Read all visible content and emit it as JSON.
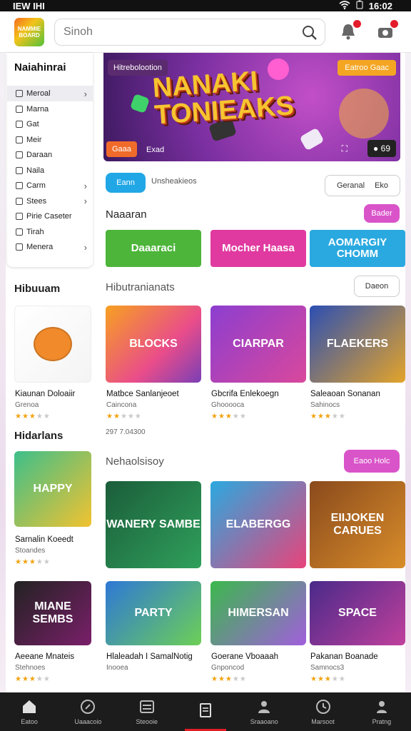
{
  "status": {
    "left": "IEW IHI",
    "right": "16:02"
  },
  "header": {
    "logo_text": "NAMMIE BOARD",
    "search_placeholder": "Sinoh"
  },
  "sidebar": {
    "title": "Naiahinrai",
    "items": [
      {
        "label": "Meroal",
        "chevron": true,
        "active": true
      },
      {
        "label": "Marna",
        "chevron": false
      },
      {
        "label": "Gat",
        "chevron": false
      },
      {
        "label": "Meir",
        "chevron": false
      },
      {
        "label": "Daraan",
        "chevron": false
      },
      {
        "label": "Naila",
        "chevron": false
      },
      {
        "label": "Carm",
        "chevron": true
      },
      {
        "label": "Stees",
        "chevron": true
      },
      {
        "label": "Pirie Caseter",
        "chevron": false
      },
      {
        "label": "Tirah",
        "chevron": false
      },
      {
        "label": "Menera",
        "chevron": true
      }
    ]
  },
  "hero": {
    "tag": "Hitrebolootion",
    "cta": "Eatroo Gaac",
    "title_line1": "NANAKI",
    "title_line2": "TONIEAKS",
    "badge": "Gaaa",
    "badge2": "Exad",
    "counter": "69"
  },
  "filters": {
    "primary": "Eann",
    "subtitle": "Unsheakieos",
    "secondary_a": "Geranal",
    "secondary_b": "Eko"
  },
  "featured": {
    "title": "Naaaran",
    "button": "Bader",
    "banners": [
      {
        "label": "Daaaraci",
        "color": "#4db53a"
      },
      {
        "label": "Mocher Haasa",
        "color": "#e03aa0"
      },
      {
        "label": "AOMARGIY CHOMM",
        "color": "#2aa9e0"
      }
    ]
  },
  "section1": {
    "title": "Hibuuam",
    "subtitle": "Hibutranianats",
    "button": "Daeon",
    "cards": [
      {
        "title": "Kiaunan Doloaiir",
        "sub": "Grenoa",
        "rating": 3,
        "art": "FOX"
      },
      {
        "title": "Matbce Sanlanjeoet",
        "sub": "Caincona",
        "rating": 2,
        "art": "BLOCKS"
      },
      {
        "title": "Gbcrifa Enlekoegn",
        "sub": "Ghooooca",
        "rating": 3,
        "art": "CIARPAR"
      },
      {
        "title": "Saleaoan Sonanan",
        "sub": "Sahinocs",
        "rating": 3,
        "art": "FLAEKERS"
      }
    ],
    "meta": "297 7.04300"
  },
  "section2": {
    "title": "Hidarlans",
    "subtitle": "Nehaolsisoy",
    "button": "Eaoo Holc",
    "cards": [
      {
        "title": "Sarnalin Koeedt",
        "sub": "Stoandes",
        "rating": 3,
        "art": "HAPPY"
      },
      {
        "title": "",
        "sub": "",
        "rating": 0,
        "art": "WANERY SAMBE"
      },
      {
        "title": "",
        "sub": "",
        "rating": 0,
        "art": "ELABERGG"
      },
      {
        "title": "",
        "sub": "",
        "rating": 0,
        "art": "EIIJOKEN CARUES"
      }
    ]
  },
  "section3": {
    "cards": [
      {
        "title": "Aeeane Mnateis",
        "sub": "Stehnoes",
        "rating": 3,
        "art": "MIANE SEMBS"
      },
      {
        "title": "Hlaleadah I SamalNotig",
        "sub": "Inooea",
        "rating": 0,
        "art": "PARTY"
      },
      {
        "title": "Goerane Vboaaah",
        "sub": "Gnponcod",
        "rating": 3,
        "art": "HIMERSAN"
      },
      {
        "title": "Pakanan Boanade",
        "sub": "Samnocs3",
        "rating": 3,
        "art": "SPACE"
      }
    ]
  },
  "bottom_nav": [
    {
      "label": "Eatoo",
      "icon": "home-icon",
      "active": false
    },
    {
      "label": "Uaaacoio",
      "icon": "compass-icon",
      "active": false
    },
    {
      "label": "Steooie",
      "icon": "list-icon",
      "active": false
    },
    {
      "label": "",
      "icon": "document-icon",
      "active": true
    },
    {
      "label": "Sraaoano",
      "icon": "person-icon",
      "active": false
    },
    {
      "label": "Marsoot",
      "icon": "clock-icon",
      "active": false
    },
    {
      "label": "Pratng",
      "icon": "user-icon",
      "active": false
    }
  ]
}
